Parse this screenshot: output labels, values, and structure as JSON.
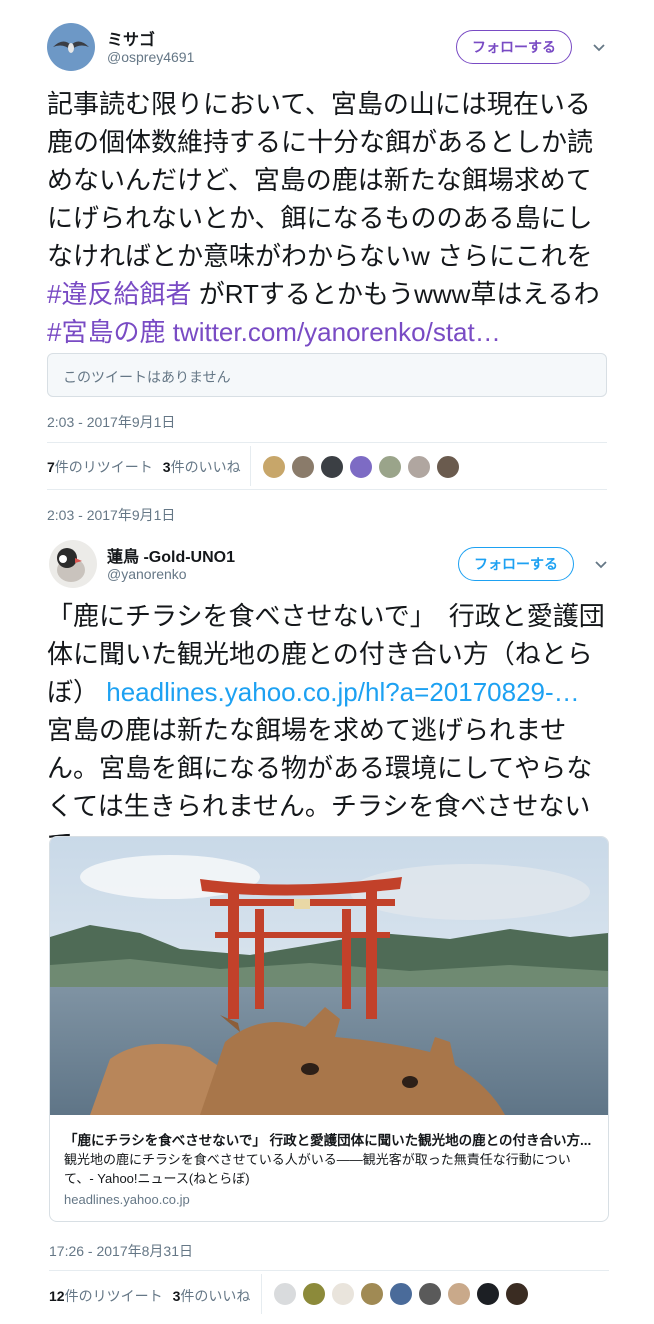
{
  "tweet1": {
    "display_name": "ミサゴ",
    "handle": "@osprey4691",
    "follow_label": "フォローする",
    "text_plain_1": "記事読む限りにおいて、宮島の山には現在いる鹿の個体数維持するに十分な餌があるとしか読めないんだけど、宮島の鹿は新たな餌場求めてにげられないとか、餌になるもののある島にしなければとか意味がわからないw さらにこれを ",
    "hashtag_1": "#違反給餌者",
    "text_plain_2": " がRTするとかもうwww草はえるわ",
    "hashtag_2": "#宮島の鹿",
    "link": "twitter.com/yanorenko/stat…",
    "quote_unavailable": "このツイートはありません",
    "timestamp": "2:03 - 2017年9月1日",
    "retweet_count": "7",
    "retweet_label": "件のリツイート",
    "like_count": "3",
    "like_label": "件のいいね"
  },
  "reply_timestamp": "2:03 - 2017年9月1日",
  "tweet2": {
    "display_name": "蓮鳥 -Gold-UNO1",
    "handle": "@yanorenko",
    "follow_label": "フォローする",
    "text_plain_1": "「鹿にチラシを食べさせないで」　行政と愛護団体に聞いた観光地の鹿との付き合い方（ねとらぼ） ",
    "link": "headlines.yahoo.co.jp/hl?a=20170829-…",
    "text_plain_2": " 宮島の鹿は新たな餌場を求めて逃げられません。宮島を餌になる物がある環境にしてやらなくては生きられません。チラシを食べさせないで。",
    "card": {
      "title": "「鹿にチラシを食べさせないで」 行政と愛護団体に聞いた観光地の鹿との付き合い方...",
      "description": "観光地の鹿にチラシを食べさせている人がいる――観光客が取った無責任な行動について、- Yahoo!ニュース(ねとらぼ)",
      "domain": "headlines.yahoo.co.jp"
    },
    "timestamp": "17:26 - 2017年8月31日",
    "retweet_count": "12",
    "retweet_label": "件のリツイート",
    "like_count": "3",
    "like_label": "件のいいね"
  },
  "colors": {
    "hashtag": "#794bc4",
    "link_blue": "#1da1f2",
    "muted": "#657786",
    "follow_purple": "#794bc4"
  },
  "icons": [
    "chevron-down-icon"
  ]
}
